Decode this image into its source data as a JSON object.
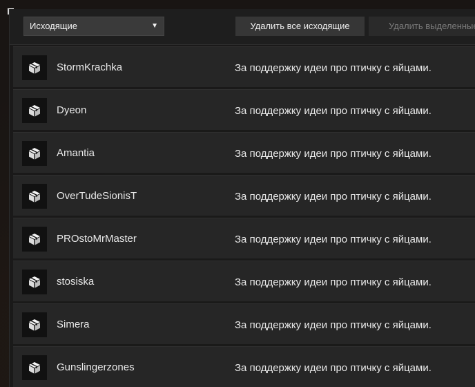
{
  "toolbar": {
    "filter_select": {
      "selected": "Исходящие",
      "arrow_icon": "caret-down-icon"
    },
    "delete_all_label": "Удалить все исходящие",
    "delete_selected_label": "Удалить выделенные"
  },
  "requests": [
    {
      "name": "StormKrachka",
      "message": "За поддержку идеи про птичку с яйцами.",
      "icon": "gift-box-icon"
    },
    {
      "name": "Dyeon",
      "message": "За поддержку идеи про птичку с яйцами.",
      "icon": "gift-box-icon"
    },
    {
      "name": "Amantia",
      "message": "За поддержку идеи про птичку с яйцами.",
      "icon": "gift-box-icon"
    },
    {
      "name": "OverTudeSionisT",
      "message": "За поддержку идеи про птичку с яйцами.",
      "icon": "gift-box-icon"
    },
    {
      "name": "PROstoMrMaster",
      "message": "За поддержку идеи про птичку с яйцами.",
      "icon": "gift-box-icon"
    },
    {
      "name": "stosiska",
      "message": "За поддержку идеи про птичку с яйцами.",
      "icon": "gift-box-icon"
    },
    {
      "name": "Simera",
      "message": "За поддержку идеи про птичку с яйцами.",
      "icon": "gift-box-icon"
    },
    {
      "name": "Gunslingerzones",
      "message": "За поддержку идеи про птичку с яйцами.",
      "icon": "gift-box-icon"
    }
  ],
  "colors": {
    "panel_bg": "#1a1a1a",
    "row_bg": "#262626",
    "text": "#e9e9e9",
    "disabled_text": "#7a7a7a"
  }
}
